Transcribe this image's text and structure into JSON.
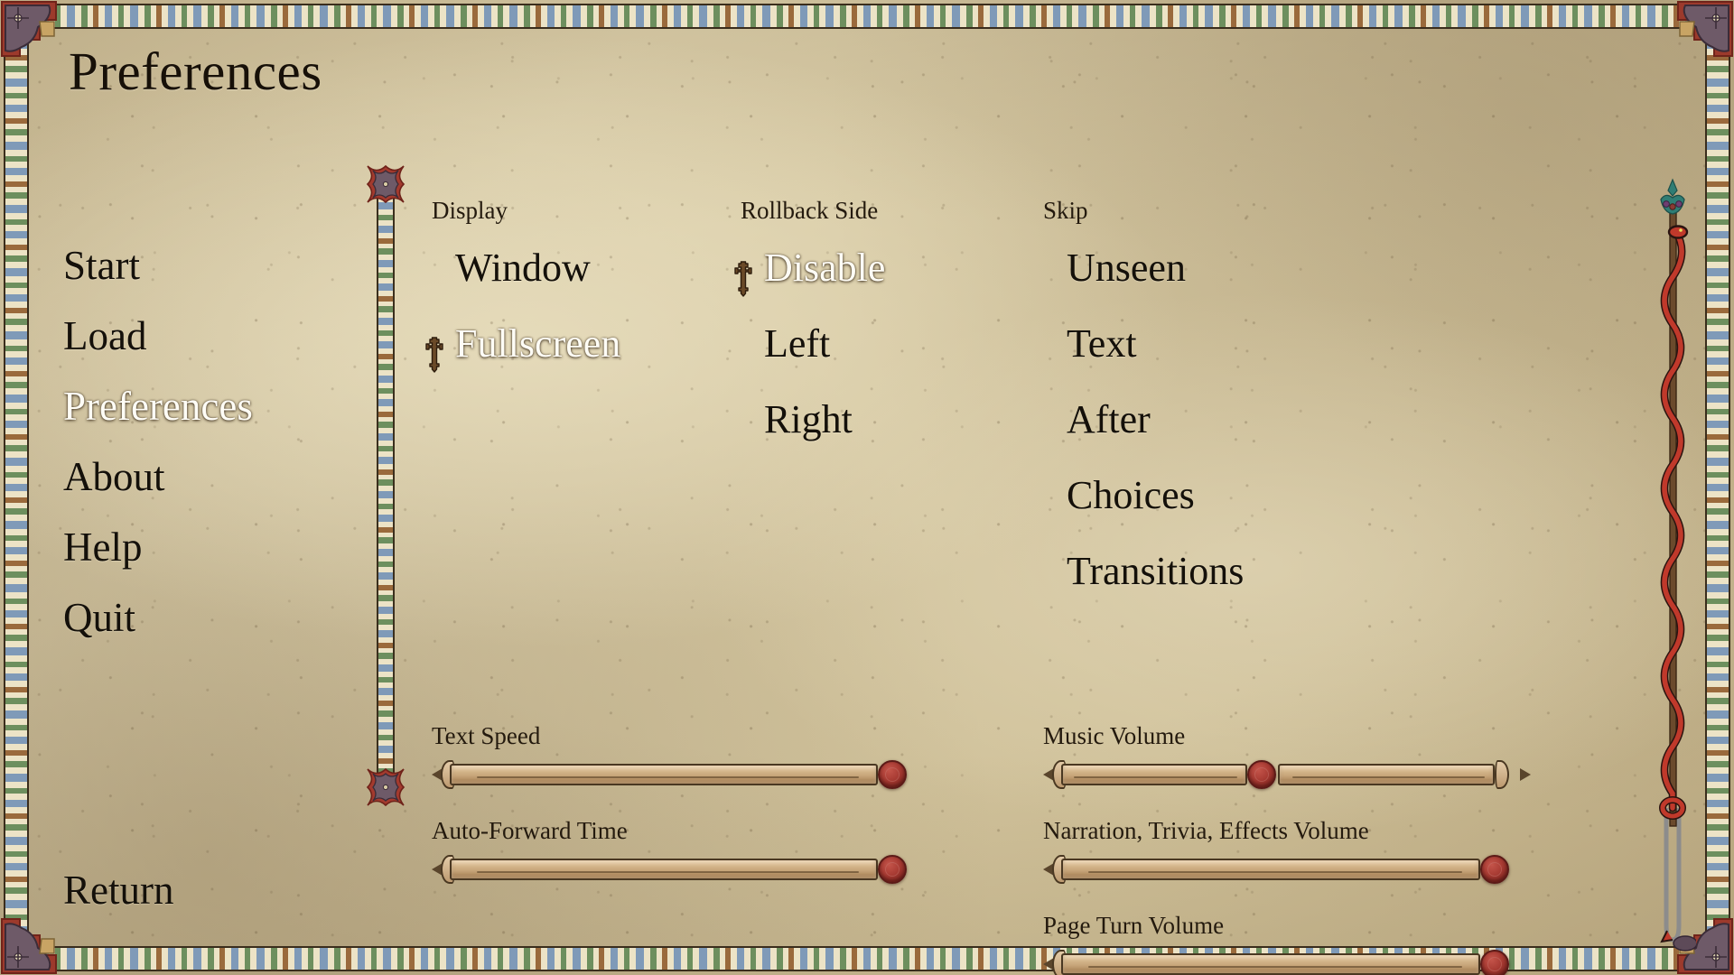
{
  "window": {
    "title": "Preferences"
  },
  "nav": {
    "items": [
      {
        "label": "Start",
        "selected": false
      },
      {
        "label": "Load",
        "selected": false
      },
      {
        "label": "Preferences",
        "selected": true
      },
      {
        "label": "About",
        "selected": false
      },
      {
        "label": "Help",
        "selected": false
      },
      {
        "label": "Quit",
        "selected": false
      }
    ],
    "return_label": "Return"
  },
  "groups": {
    "display": {
      "label": "Display",
      "options": [
        {
          "label": "Window",
          "selected": false
        },
        {
          "label": "Fullscreen",
          "selected": true
        }
      ]
    },
    "rollback_side": {
      "label": "Rollback Side",
      "options": [
        {
          "label": "Disable",
          "selected": true
        },
        {
          "label": "Left",
          "selected": false
        },
        {
          "label": "Right",
          "selected": false
        }
      ]
    },
    "skip": {
      "label": "Skip",
      "options": [
        {
          "label": "Unseen",
          "selected": false
        },
        {
          "label": "Text",
          "selected": false
        },
        {
          "label": "After",
          "selected": false
        },
        {
          "label": "Choices",
          "selected": false
        },
        {
          "label": "Transitions",
          "selected": false
        }
      ]
    }
  },
  "sliders": [
    {
      "id": "text-speed",
      "label": "Text Speed",
      "value": 100
    },
    {
      "id": "auto-forward",
      "label": "Auto-Forward Time",
      "value": 100
    },
    {
      "id": "music",
      "label": "Music Volume",
      "value": 45
    },
    {
      "id": "narration",
      "label": "Narration, Trivia, Effects Volume",
      "value": 100
    },
    {
      "id": "pageturn",
      "label": "Page Turn Volume",
      "value": 100
    }
  ],
  "icons": {
    "selection_marker": "ornate-cross-icon",
    "slider_knob": "wax-seal-icon",
    "divider_end": "quatrefoil-icon",
    "scrollbar": "serpent-staff-icon",
    "corner": "corner-ornament-icon"
  },
  "colors": {
    "parchment": "#d2c49e",
    "ink": "#14100a",
    "selected_text": "#fffdf6",
    "marker_brown": "#6b4a28",
    "wax_red": "#a83b33",
    "border_blue": "#7f9ab8",
    "border_green": "#6d8f5e",
    "border_cream": "#ece3c6",
    "ornament_purple": "#6e5a68",
    "ornament_red": "#a33a2e",
    "serpent_red": "#c0392b"
  },
  "scrollbar": {
    "thumb_top_pct": 0,
    "thumb_height_pct": 78
  }
}
